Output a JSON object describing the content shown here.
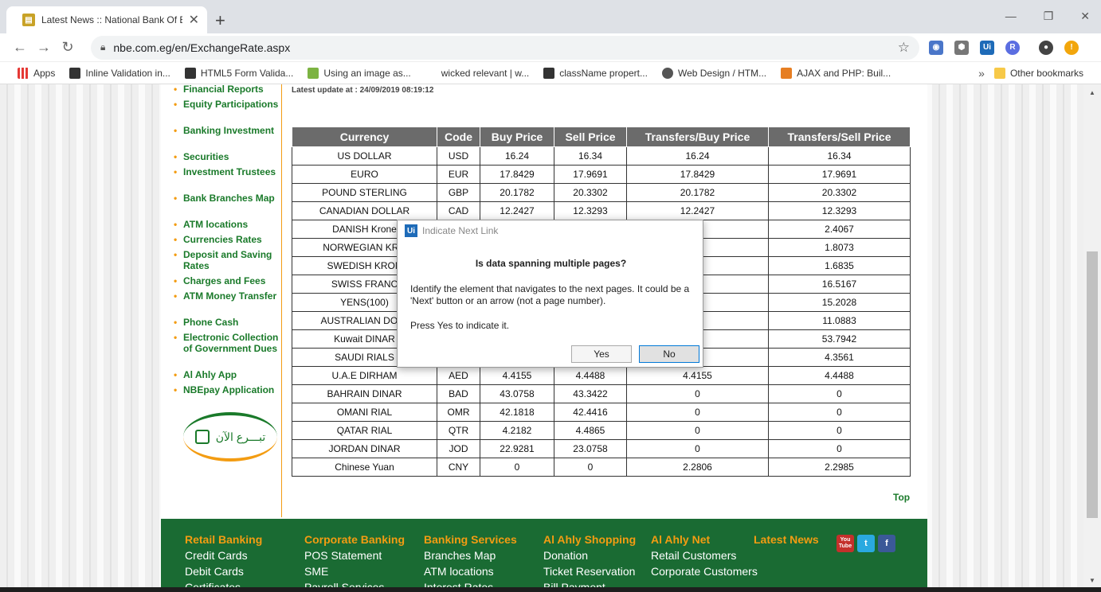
{
  "browser": {
    "tab_title": "Latest News :: National Bank Of E",
    "tab_close": "✕",
    "new_tab": "+",
    "url": "nbe.com.eg/en/ExchangeRate.aspx",
    "bookmarks": [
      {
        "label": "Apps",
        "icon": "apps-grid-icon",
        "color": "#e53935"
      },
      {
        "label": "Inline Validation in...",
        "icon": "bookmark-site-icon",
        "color": "#333333"
      },
      {
        "label": "HTML5 Form Valida...",
        "icon": "bookmark-site-icon",
        "color": "#333333"
      },
      {
        "label": "Using an image as...",
        "icon": "bookmark-site-icon",
        "color": "#7cb342"
      },
      {
        "label": "wicked relevant | w...",
        "icon": "bookmark-site-icon",
        "color": "#ffffff"
      },
      {
        "label": "className propert...",
        "icon": "bookmark-site-icon",
        "color": "#333333"
      },
      {
        "label": "Web Design / HTM...",
        "icon": "bookmark-site-icon",
        "color": "#555555"
      },
      {
        "label": "AJAX and PHP: Buil...",
        "icon": "bookmark-site-icon",
        "color": "#e67e22"
      }
    ],
    "bookmarks_more": "»",
    "other_bookmarks": "Other bookmarks"
  },
  "sidebar": {
    "items": [
      {
        "label": "Financial Reports"
      },
      {
        "label": "Equity Participations"
      },
      {
        "label": "Banking Investment"
      },
      {
        "label": "Securities"
      },
      {
        "label": "Investment Trustees"
      },
      {
        "label": "Bank Branches Map"
      },
      {
        "label": "ATM locations"
      },
      {
        "label": "Currencies Rates"
      },
      {
        "label": "Deposit and Saving Rates"
      },
      {
        "label": "Charges and Fees"
      },
      {
        "label": "ATM Money Transfer"
      },
      {
        "label": "Phone Cash"
      },
      {
        "label": "Electronic Collection of Government Dues"
      },
      {
        "label": "Al Ahly App"
      },
      {
        "label": "NBEpay Application"
      }
    ],
    "donate_text": "تبـــرع الآن"
  },
  "main": {
    "update_text": "Latest update at : 24/09/2019 08:19:12",
    "columns": [
      "Currency",
      "Code",
      "Buy Price",
      "Sell Price",
      "Transfers/Buy Price",
      "Transfers/Sell Price"
    ],
    "rows": [
      [
        "US DOLLAR",
        "USD",
        "16.24",
        "16.34",
        "16.24",
        "16.34"
      ],
      [
        "EURO",
        "EUR",
        "17.8429",
        "17.9691",
        "17.8429",
        "17.9691"
      ],
      [
        "POUND STERLING",
        "GBP",
        "20.1782",
        "20.3302",
        "20.1782",
        "20.3302"
      ],
      [
        "CANADIAN DOLLAR",
        "CAD",
        "12.2427",
        "12.3293",
        "12.2427",
        "12.3293"
      ],
      [
        "DANISH Krone",
        "",
        "",
        "",
        "96",
        "2.4067"
      ],
      [
        "NORWEGIAN KRO",
        "",
        "",
        "",
        "44",
        "1.8073"
      ],
      [
        "SWEDISH KRON",
        "",
        "",
        "",
        "15",
        "1.6835"
      ],
      [
        "SWISS FRANC",
        "",
        "",
        "",
        "75",
        "16.5167"
      ],
      [
        "YENS(100)",
        "",
        "",
        "",
        "17",
        "15.2028"
      ],
      [
        "AUSTRALIAN DOLL",
        "",
        "",
        "",
        "38",
        "11.0883"
      ],
      [
        "Kuwait DINAR",
        "",
        "",
        "",
        "62",
        "53.7942"
      ],
      [
        "SAUDI RIALS",
        "",
        "",
        "",
        "15",
        "4.3561"
      ],
      [
        "U.A.E DIRHAM",
        "AED",
        "4.4155",
        "4.4488",
        "4.4155",
        "4.4488"
      ],
      [
        "BAHRAIN DINAR",
        "BAD",
        "43.0758",
        "43.3422",
        "0",
        "0"
      ],
      [
        "OMANI RIAL",
        "OMR",
        "42.1818",
        "42.4416",
        "0",
        "0"
      ],
      [
        "QATAR RIAL",
        "QTR",
        "4.2182",
        "4.4865",
        "0",
        "0"
      ],
      [
        "JORDAN DINAR",
        "JOD",
        "22.9281",
        "23.0758",
        "0",
        "0"
      ],
      [
        "Chinese Yuan",
        "CNY",
        "0",
        "0",
        "2.2806",
        "2.2985"
      ]
    ],
    "top_link": "Top"
  },
  "footer": {
    "columns": [
      {
        "title": "Retail Banking",
        "links": [
          "Credit Cards",
          "Debit Cards",
          "Certificates"
        ]
      },
      {
        "title": "Corporate Banking",
        "links": [
          "POS Statement",
          "SME",
          "Payroll Services"
        ]
      },
      {
        "title": "Banking Services",
        "links": [
          "Branches Map",
          "ATM locations",
          "Interest Rates"
        ]
      },
      {
        "title": "Al Ahly Shopping",
        "links": [
          "Donation",
          "Ticket Reservation",
          "Bill Payment"
        ]
      },
      {
        "title": "Al Ahly Net",
        "links": [
          "Retail Customers",
          "Corporate Customers"
        ]
      },
      {
        "title": "Latest News",
        "links": []
      }
    ],
    "social": [
      {
        "label": "You Tube",
        "icon": "youtube-icon",
        "color": "#c4302b"
      },
      {
        "label": "t",
        "icon": "twitter-icon",
        "color": "#2aa9e0"
      },
      {
        "label": "f",
        "icon": "facebook-icon",
        "color": "#3b5998"
      }
    ]
  },
  "dialog": {
    "title": "Indicate Next Link",
    "icon_text": "Ui",
    "question": "Is data spanning multiple pages?",
    "body": "Identify the element that navigates to the next pages. It could be a 'Next' button or an arrow (not a page number).",
    "hint": "Press Yes to indicate it.",
    "yes_label": "Yes",
    "no_label": "No"
  }
}
